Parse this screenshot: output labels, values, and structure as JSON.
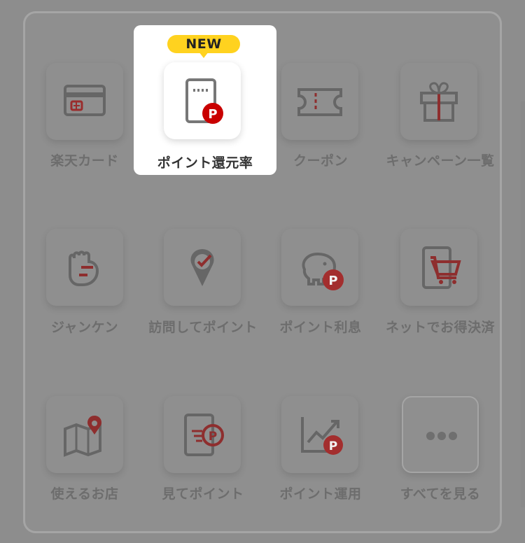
{
  "menu": {
    "badge": "NEW",
    "items": [
      {
        "label": "楽天カード",
        "icon": "credit-card-icon"
      },
      {
        "label": "ポイント還元率",
        "icon": "point-rate-icon"
      },
      {
        "label": "クーポン",
        "icon": "coupon-icon"
      },
      {
        "label": "キャンペーン一覧",
        "icon": "gift-icon"
      },
      {
        "label": "ジャンケン",
        "icon": "fist-icon"
      },
      {
        "label": "訪問してポイント",
        "icon": "location-check-icon"
      },
      {
        "label": "ポイント利息",
        "icon": "piggy-bank-icon"
      },
      {
        "label": "ネットでお得決済",
        "icon": "shopping-cart-icon"
      },
      {
        "label": "使えるお店",
        "icon": "map-pin-icon"
      },
      {
        "label": "見てポイント",
        "icon": "watch-point-icon"
      },
      {
        "label": "ポイント運用",
        "icon": "chart-up-icon"
      },
      {
        "label": "すべてを見る",
        "icon": "more-icon"
      }
    ]
  },
  "colors": {
    "overlay": "#8d8d8d",
    "icon_gray": "#666666",
    "accent_red": "#bf0000",
    "badge_yellow": "#ffd21f"
  }
}
